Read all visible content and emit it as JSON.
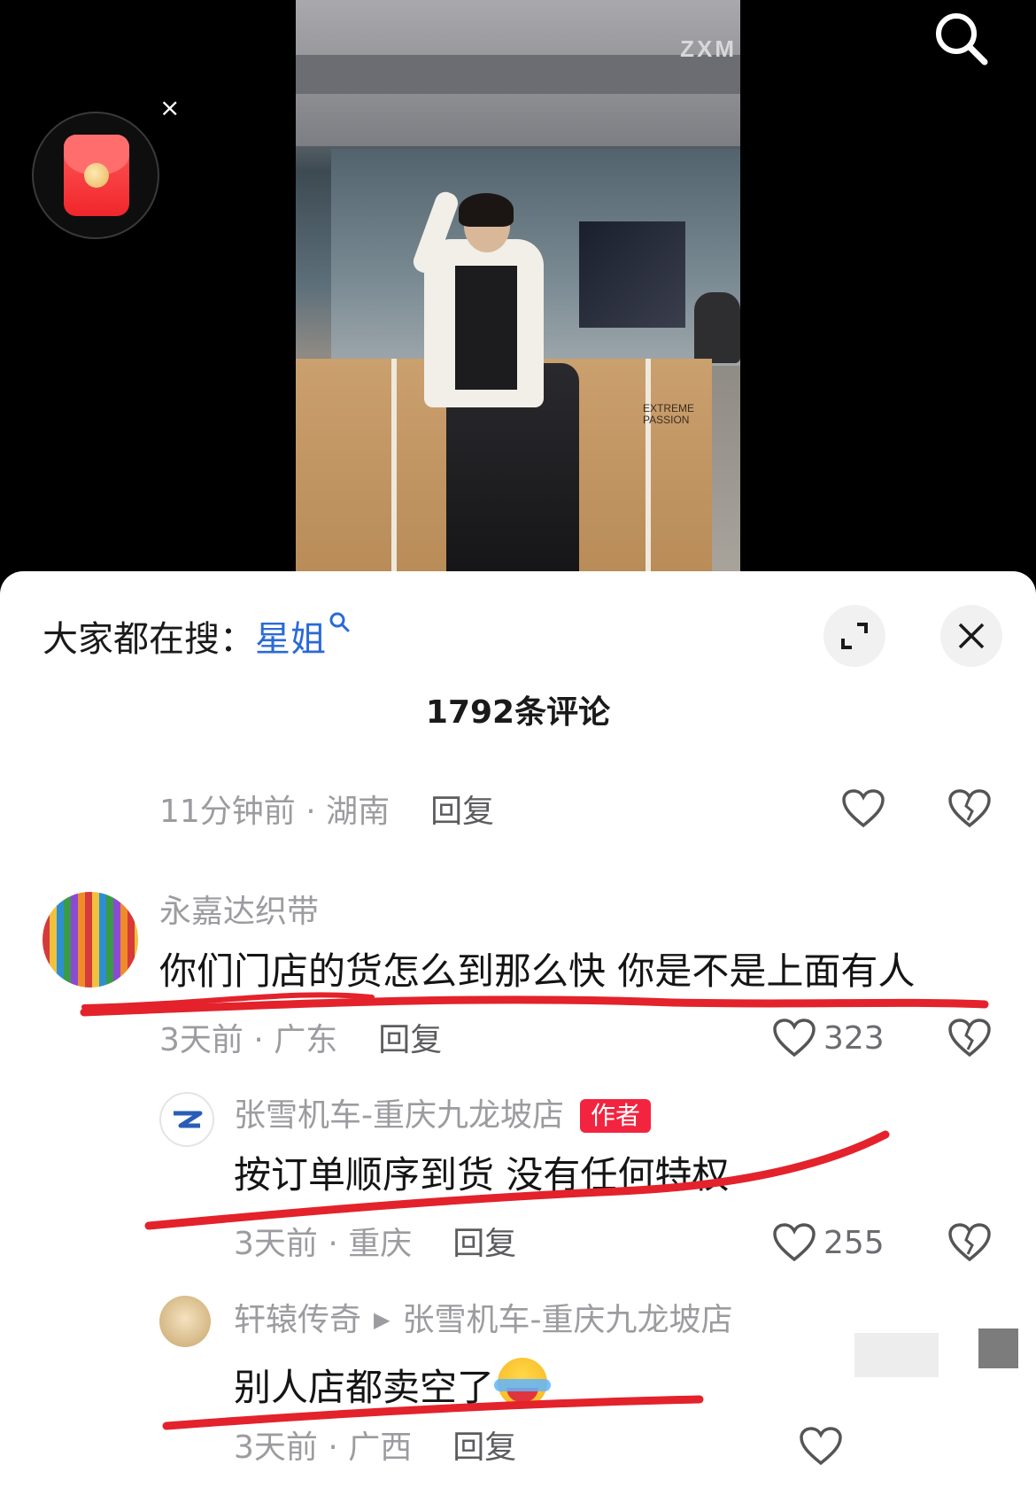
{
  "video": {
    "brand_text": "ZXM",
    "box_label": "EXTREME\nPASSION"
  },
  "hot_search": {
    "prefix": "大家都在搜：",
    "keyword": "星姐"
  },
  "comment_count": "1792条评论",
  "top_meta": {
    "time_location": "11分钟前 · 湖南",
    "reply": "回复"
  },
  "comments": [
    {
      "username": "永嘉达织带",
      "text": "你们门店的货怎么到那么快 你是不是上面有人",
      "time_location": "3天前 · 广东",
      "reply": "回复",
      "likes": "323"
    },
    {
      "username": "张雪机车-重庆九龙坡店",
      "badge": "作者",
      "text": "按订单顺序到货 没有任何特权",
      "time_location": "3天前 · 重庆",
      "reply": "回复",
      "likes": "255"
    },
    {
      "username": "轩辕传奇",
      "reply_to": "张雪机车-重庆九龙坡店",
      "text": "别人店都卖空了",
      "time_location": "3天前 · 广西",
      "reply": "回复"
    }
  ],
  "colors": {
    "keyword": "#2a6ad6",
    "badge": "#f2243f",
    "underline": "#e3222b"
  },
  "icons": [
    "red-packet-icon",
    "close-icon",
    "search-icon",
    "expand-icon",
    "heart-icon",
    "broken-heart-icon",
    "crying-laughing-emoji"
  ]
}
